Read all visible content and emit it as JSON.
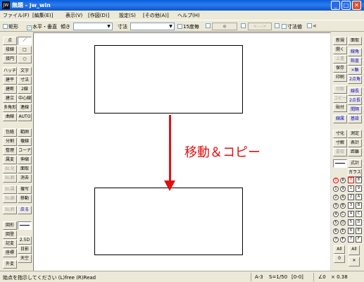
{
  "window": {
    "title": "無題 - jw_win",
    "icon_text": "JW"
  },
  "menu": [
    "ファイル(F)",
    "[編集(E)]",
    "表示(V)",
    "[作図(D)]",
    "設定(S)",
    "[その他(A)]",
    "ヘルプ(H)"
  ],
  "toolbar": {
    "rect_label": "矩形",
    "hv_label": "水平・垂直",
    "slope_label": "傾き",
    "dim_label": "寸法",
    "deg15_label": "15度毎",
    "btn1": "●",
    "btn2": "<---->",
    "dimval_label": "寸法値",
    "lt_label": "<"
  },
  "left_tools": {
    "row1": [
      "点",
      "／"
    ],
    "row2": [
      "接線",
      "□"
    ],
    "row3": [
      "接円",
      "○"
    ],
    "row4": [
      "ハッチ",
      "文字"
    ],
    "row5": [
      "建平",
      "寸法"
    ],
    "row6": [
      "建断",
      "2線"
    ],
    "row7": [
      "建立",
      "中心線"
    ],
    "row8": [
      "多角形",
      "連線"
    ],
    "row9": [
      "曲線",
      "AUTO"
    ],
    "row10": [
      "包絡",
      "範囲"
    ],
    "row11": [
      "分割",
      "複線"
    ],
    "row12": [
      "整理",
      "コーナー"
    ],
    "row13": [
      "属変",
      "伸縮"
    ],
    "row14": [
      "BL化",
      "面取"
    ],
    "row15": [
      "BL解",
      "消去"
    ],
    "row16": [
      "BL属",
      "複写"
    ],
    "row17": [
      "BL編",
      "移動"
    ],
    "row18": [
      "BL終",
      "戻る"
    ],
    "row19": [
      "図形",
      ""
    ],
    "row20": [
      "図登",
      "2.5D"
    ],
    "row21": [
      "記変",
      "日影"
    ],
    "row22": [
      "座標",
      "天空"
    ],
    "row23": [
      "外変",
      ""
    ]
  },
  "right_tools": {
    "row1": [
      "新規",
      "開く",
      "上書",
      "保存",
      "印刷",
      "切取",
      "コピー",
      "貼付",
      "線属"
    ],
    "row2": [
      "線角",
      "鉛直",
      "×軸",
      "2点角",
      "線長",
      "2点長",
      "間隔",
      "基設"
    ],
    "row3": [
      "寸化",
      "寸解",
      "測定",
      "表計",
      "距離",
      "式計",
      "ガラス"
    ],
    "layer_all": "All",
    "layer_zero": "0",
    "group_all": "All",
    "group_x": "✕"
  },
  "layers": {
    "circles_left": [
      "0",
      "1",
      "2",
      "3",
      "4",
      "5",
      "6",
      "7"
    ],
    "circles_right": [
      "8",
      "9",
      "A",
      "B",
      "C",
      "D",
      "E",
      "F"
    ],
    "squares": [
      "0",
      "1",
      "2",
      "3",
      "4",
      "5",
      "6",
      "7"
    ],
    "squares_right": [
      "8",
      "9",
      "A",
      "B",
      "C",
      "D",
      "E",
      "F"
    ]
  },
  "canvas": {
    "label": "移動＆コピー"
  },
  "status": {
    "message": "始点を指示してください (L)free (R)Read",
    "paper": "A-3",
    "scale": "S=1/50",
    "layer": "[0-0]",
    "angle": "∠0",
    "zoom": "× 0.38"
  }
}
